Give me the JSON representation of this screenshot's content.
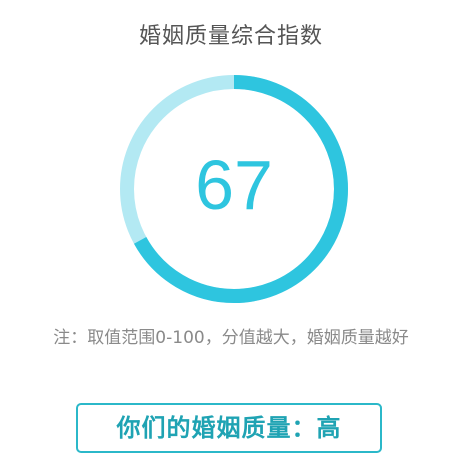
{
  "title": "婚姻质量综合指数",
  "gauge": {
    "value": 67,
    "value_text": "67",
    "min": 0,
    "max": 100,
    "colors": {
      "filled": "#2ec5df",
      "track": "#b3e9f3"
    }
  },
  "note": "注：取值范围0-100，分值越大，婚姻质量越好",
  "result": {
    "text": "你们的婚姻质量：高",
    "border_color": "#2bb8c9",
    "text_color": "#1fa3b3"
  }
}
